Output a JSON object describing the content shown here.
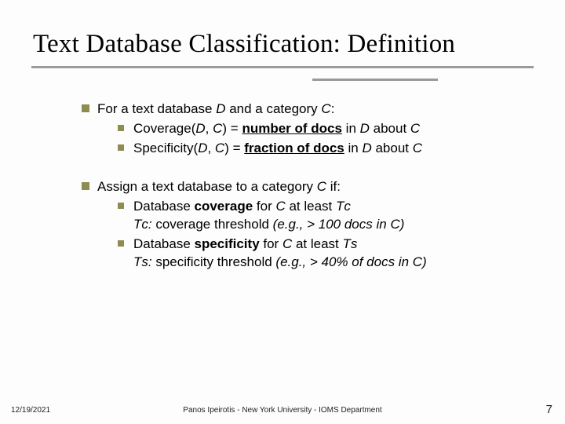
{
  "title": "Text Database Classification: Definition",
  "b1": {
    "intro_a": "For a text database ",
    "intro_b": " and a category ",
    "intro_c": ":",
    "D": "D",
    "C": "C",
    "s1": {
      "a": "Coverage(",
      "b": ") = ",
      "num": "number of docs",
      "c": " in ",
      "d": " about "
    },
    "s2": {
      "a": "Specificity(",
      "b": ") = ",
      "frac": "fraction of docs",
      "c": " in ",
      "d": " about "
    }
  },
  "b2": {
    "intro_a": "Assign a text database to a category ",
    "intro_b": " if:",
    "C": "C",
    "s1": {
      "a": "Database ",
      "cov": "coverage",
      "b": " for ",
      "c": " at least ",
      "tc": "Τc",
      "detail_a": "Τc:",
      "detail_b": " coverage threshold ",
      "detail_c": "(e.g., > 100 docs in C)"
    },
    "s2": {
      "a": "Database ",
      "spec": "specificity",
      "b": " for ",
      "c": " at least ",
      "ts": "Τs",
      "detail_a": "Τs:",
      "detail_b": " specificity threshold ",
      "detail_c": "(e.g., > 40% of docs in C)"
    }
  },
  "footer": {
    "date": "12/19/2021",
    "center": "Panos Ipeirotis - New York University - IOMS Department",
    "page": "7"
  }
}
